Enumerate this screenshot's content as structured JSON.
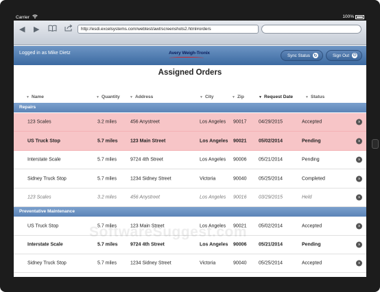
{
  "device": {
    "carrier": "Carrier",
    "clock": "",
    "battery": "100%"
  },
  "browser": {
    "url": "http://esdi.excelsystems.com/webtest/awt/screenshots2.html#orders"
  },
  "header": {
    "logged_in": "Logged in as Mike Dietz",
    "logo": "Avery Weigh-Tronix",
    "sync_label": "Sync Status",
    "signout_label": "Sign Out"
  },
  "page": {
    "title": "Assigned Orders"
  },
  "columns": [
    "Name",
    "Quantity",
    "Address",
    "City",
    "Zip",
    "Request Date",
    "Status"
  ],
  "sections": [
    {
      "label": "Repairs",
      "rows": [
        {
          "name": "123 Scales",
          "qty": "3.2 miles",
          "address": "456 Anystreet",
          "city": "Los Angeles",
          "zip": "90017",
          "date": "04/29/2015",
          "status": "Accepted"
        },
        {
          "name": "US Truck Stop",
          "qty": "5.7 miles",
          "address": "123 Main Street",
          "city": "Los Angeles",
          "zip": "90021",
          "date": "05/02/2014",
          "status": "Pending"
        },
        {
          "name": "Interstate Scale",
          "qty": "5.7 miles",
          "address": "9724 4th Street",
          "city": "Los Angeles",
          "zip": "90006",
          "date": "05/21/2014",
          "status": "Pending"
        },
        {
          "name": "Sidney Truck Stop",
          "qty": "5.7 miles",
          "address": "1234 Sidney Street",
          "city": "Victoria",
          "zip": "90040",
          "date": "05/25/2014",
          "status": "Completed"
        },
        {
          "name": "123 Scales",
          "qty": "3.2 miles",
          "address": "456 Anystreet",
          "city": "Los Angeles",
          "zip": "90016",
          "date": "03/29/2015",
          "status": "Held"
        }
      ]
    },
    {
      "label": "Preventative Maintenance",
      "rows": [
        {
          "name": "US Truck Stop",
          "qty": "5.7 miles",
          "address": "123 Main Street",
          "city": "Los Angeles",
          "zip": "90021",
          "date": "05/02/2014",
          "status": "Accepted"
        },
        {
          "name": "Interstate Scale",
          "qty": "5.7 miles",
          "address": "9724 4th Street",
          "city": "Los Angeles",
          "zip": "90006",
          "date": "05/21/2014",
          "status": "Pending"
        },
        {
          "name": "Sidney Truck Stop",
          "qty": "5.7 miles",
          "address": "1234 Sidney Street",
          "city": "Victoria",
          "zip": "90040",
          "date": "05/25/2014",
          "status": "Accepted"
        }
      ]
    }
  ],
  "watermark": "SoftwareSuggest.com",
  "colors": {
    "header_blue": "#3c6aa1",
    "section_blue": "#5b84b7",
    "highlight_pink": "#f7c5c7"
  },
  "icons": [
    "wifi-icon",
    "battery-icon",
    "back-icon",
    "forward-icon",
    "bookmarks-icon",
    "share-icon",
    "refresh-icon",
    "power-icon",
    "chevron-right-icon"
  ]
}
